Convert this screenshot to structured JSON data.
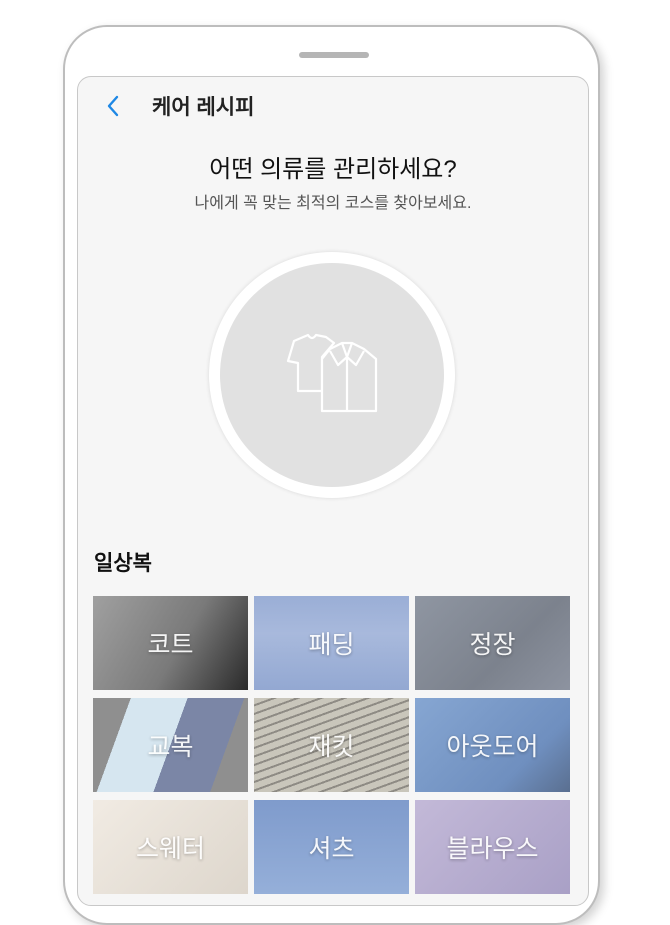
{
  "header": {
    "title": "케어 레시피",
    "back_icon": "chevron-left-icon",
    "accent": "#1e88e5"
  },
  "main": {
    "heading": "어떤 의류를 관리하세요?",
    "subheading": "나에게 꼭 맞는 최적의 코스를 찾아보세요.",
    "center_icon": "clothes-icon"
  },
  "section": {
    "title": "일상복",
    "items": [
      {
        "label": "코트",
        "color": "#8c8c8c"
      },
      {
        "label": "패딩",
        "color": "#9fb1d6"
      },
      {
        "label": "정장",
        "color": "#8a8f99"
      },
      {
        "label": "교복",
        "color": "#a9b4c8"
      },
      {
        "label": "재킷",
        "color": "#b9b6ac"
      },
      {
        "label": "아웃도어",
        "color": "#7d9ac4"
      },
      {
        "label": "스웨터",
        "color": "#e6e0d8"
      },
      {
        "label": "셔츠",
        "color": "#8ea8d4"
      },
      {
        "label": "블라우스",
        "color": "#b7aed0"
      }
    ]
  }
}
